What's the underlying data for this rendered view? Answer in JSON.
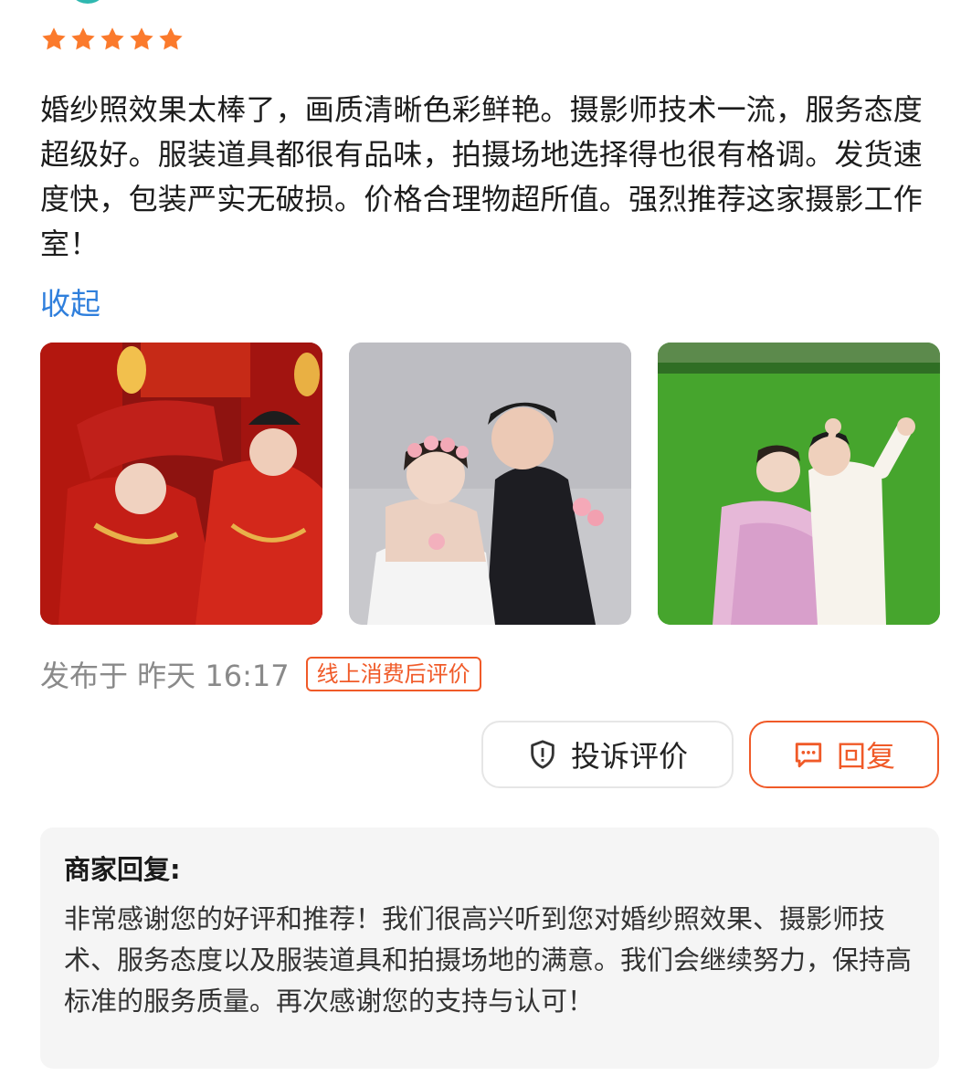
{
  "rating": {
    "stars": 5,
    "max": 5,
    "star_color": "#fb7a2c"
  },
  "review": {
    "text": "婚纱照效果太棒了，画质清晰色彩鲜艳。摄影师技术一流，服务态度超级好。服装道具都很有品味，拍摄场地选择得也很有格调。发货速度快，包装严实无破损。价格合理物超所值。强烈推荐这家摄影工作室！",
    "collapse_label": "收起"
  },
  "photos": [
    {
      "scene": "traditional-red-wedding"
    },
    {
      "scene": "studio-white-gown-portrait"
    },
    {
      "scene": "green-lawn-outdoor"
    }
  ],
  "meta": {
    "publish_time": "发布于 昨天 16:17",
    "badge": "线上消费后评价"
  },
  "actions": {
    "report_label": "投诉评价",
    "report_icon": "shield-exclamation-icon",
    "reply_label": "回复",
    "reply_icon": "chat-bubble-icon"
  },
  "merchant_reply": {
    "label": "商家回复:",
    "text": "非常感谢您的好评和推荐！我们很高兴听到您对婚纱照效果、摄影师技术、服务态度以及服装道具和拍摄场地的满意。我们会继续努力，保持高标准的服务质量。再次感谢您的支持与认可！"
  },
  "colors": {
    "accent": "#f05a28",
    "link": "#2f7fdc",
    "muted": "#8a8a8a",
    "reply_bg": "#f5f5f5"
  }
}
